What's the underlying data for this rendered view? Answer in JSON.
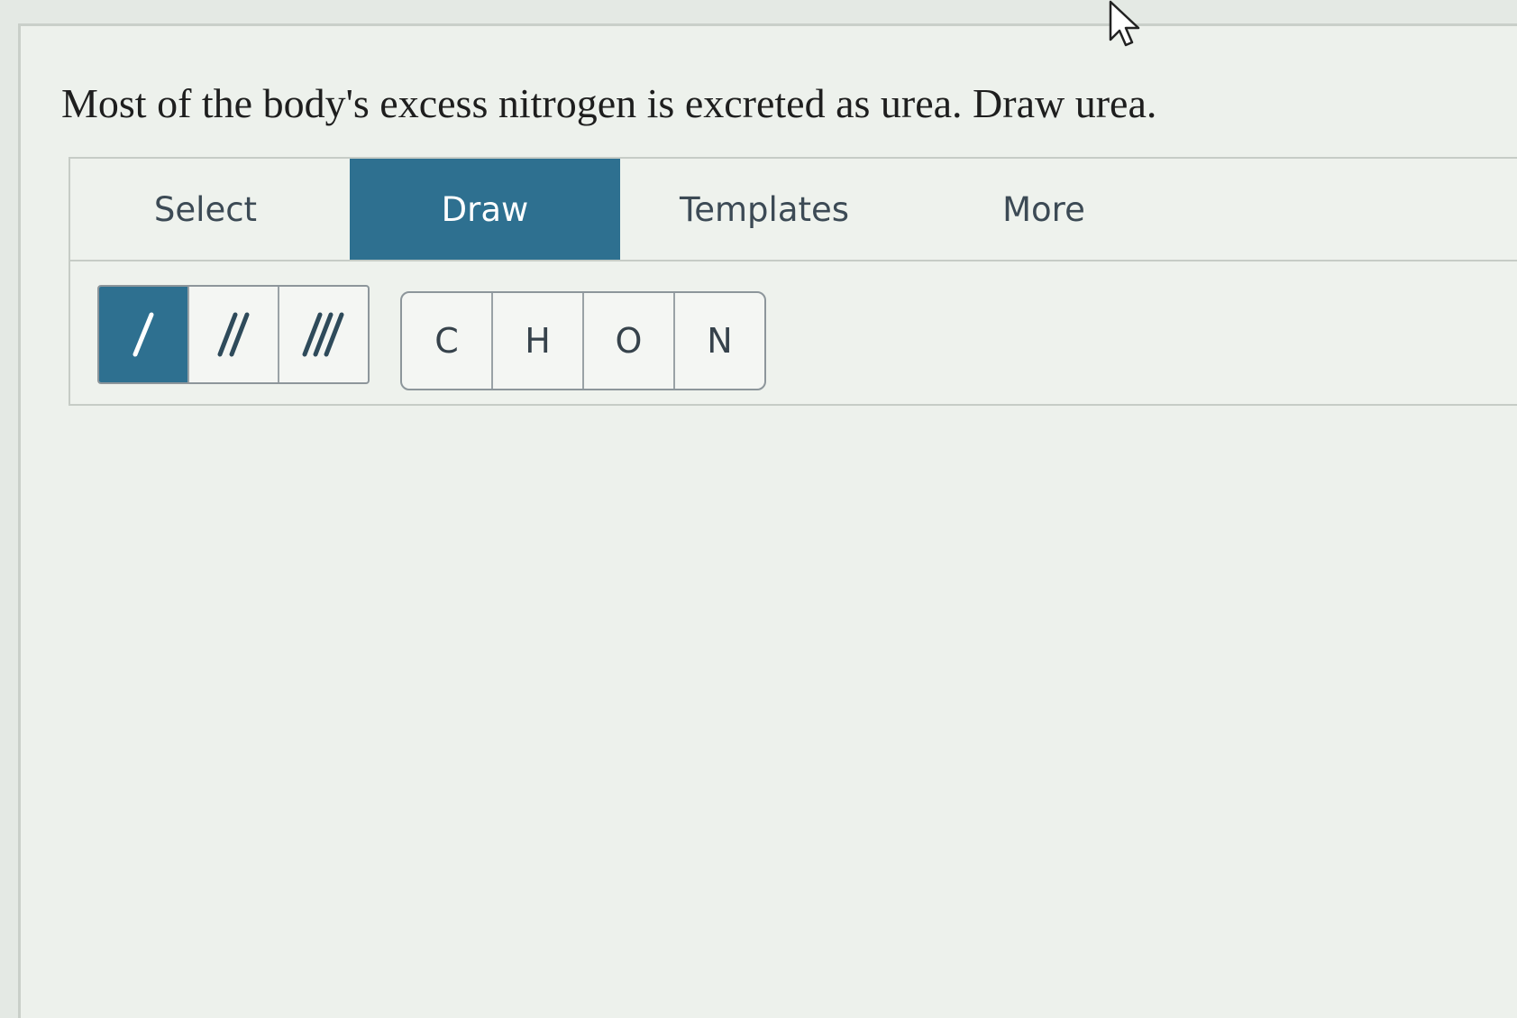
{
  "question": {
    "text": "Most of the body's excess nitrogen is excreted as urea. Draw urea."
  },
  "tabs": [
    {
      "label": "Select",
      "active": false
    },
    {
      "label": "Draw",
      "active": true
    },
    {
      "label": "Templates",
      "active": false
    },
    {
      "label": "More",
      "active": false
    }
  ],
  "bonds": [
    {
      "icon": "single-bond-icon",
      "active": true
    },
    {
      "icon": "double-bond-icon",
      "active": false
    },
    {
      "icon": "triple-bond-icon",
      "active": false
    }
  ],
  "atoms": [
    {
      "label": "C"
    },
    {
      "label": "H"
    },
    {
      "label": "O"
    },
    {
      "label": "N"
    }
  ],
  "colors": {
    "accent": "#2e7090",
    "background": "#edf1ec",
    "text": "#1e1e1e"
  }
}
